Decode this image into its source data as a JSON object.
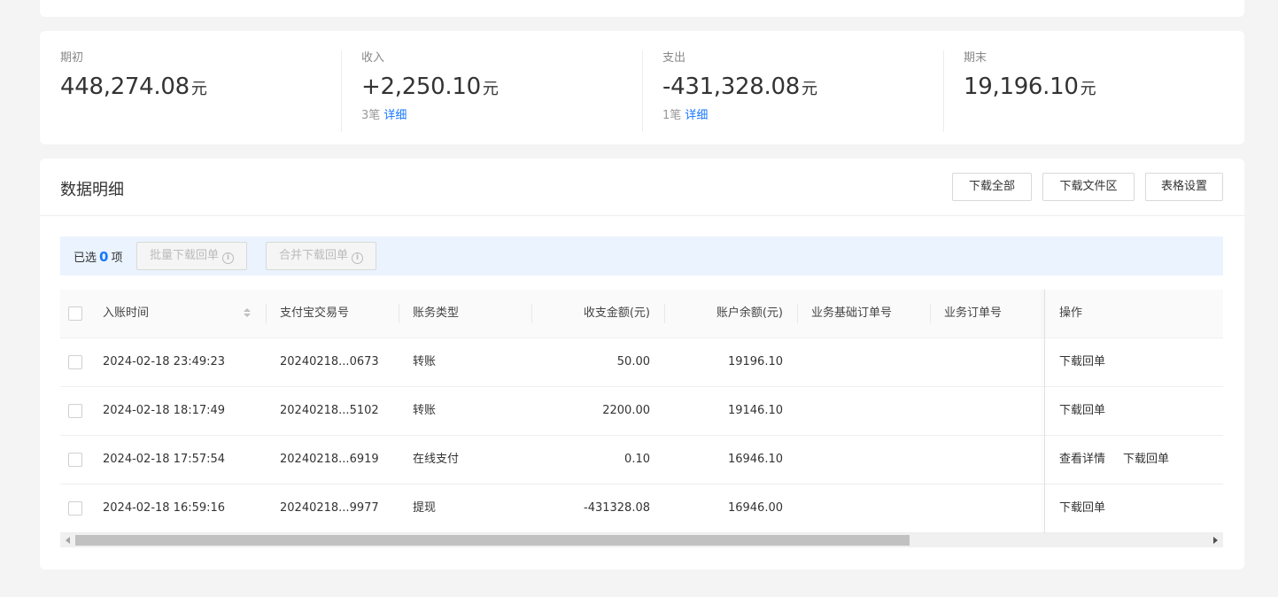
{
  "summary": {
    "opening": {
      "label": "期初",
      "value": "448,274.08",
      "unit": "元"
    },
    "income": {
      "label": "收入",
      "value": "+2,250.10",
      "unit": "元",
      "count": "3笔",
      "detail_link": "详细"
    },
    "expense": {
      "label": "支出",
      "value": "-431,328.08",
      "unit": "元",
      "count": "1笔",
      "detail_link": "详细"
    },
    "closing": {
      "label": "期末",
      "value": "19,196.10",
      "unit": "元"
    }
  },
  "detail": {
    "title": "数据明细",
    "buttons": {
      "download_all": "下载全部",
      "download_area": "下载文件区",
      "table_settings": "表格设置"
    },
    "selection": {
      "prefix": "已选",
      "count": "0",
      "suffix": "项",
      "batch_download": "批量下载回单",
      "merge_download": "合并下载回单"
    }
  },
  "table": {
    "headers": {
      "time": "入账时间",
      "trade_no": "支付宝交易号",
      "type": "账务类型",
      "amount": "收支金额(元)",
      "balance": "账户余额(元)",
      "base_order": "业务基础订单号",
      "order": "业务订单号",
      "action": "操作"
    },
    "rows": [
      {
        "time": "2024-02-18 23:49:23",
        "trade_no": "20240218...0673",
        "type": "转账",
        "amount": "50.00",
        "balance": "19196.10",
        "action1": "下载回单",
        "action2": ""
      },
      {
        "time": "2024-02-18 18:17:49",
        "trade_no": "20240218...5102",
        "type": "转账",
        "amount": "2200.00",
        "balance": "19146.10",
        "action1": "下载回单",
        "action2": ""
      },
      {
        "time": "2024-02-18 17:57:54",
        "trade_no": "20240218...6919",
        "type": "在线支付",
        "amount": "0.10",
        "balance": "16946.10",
        "action1": "查看详情",
        "action2": "下载回单"
      },
      {
        "time": "2024-02-18 16:59:16",
        "trade_no": "20240218...9977",
        "type": "提现",
        "amount": "-431328.08",
        "balance": "16946.00",
        "action1": "下载回单",
        "action2": ""
      }
    ]
  },
  "colors": {
    "accent": "#1677ff",
    "page_bg": "#f4f4f4",
    "selection_bg": "#ebf3fe"
  }
}
